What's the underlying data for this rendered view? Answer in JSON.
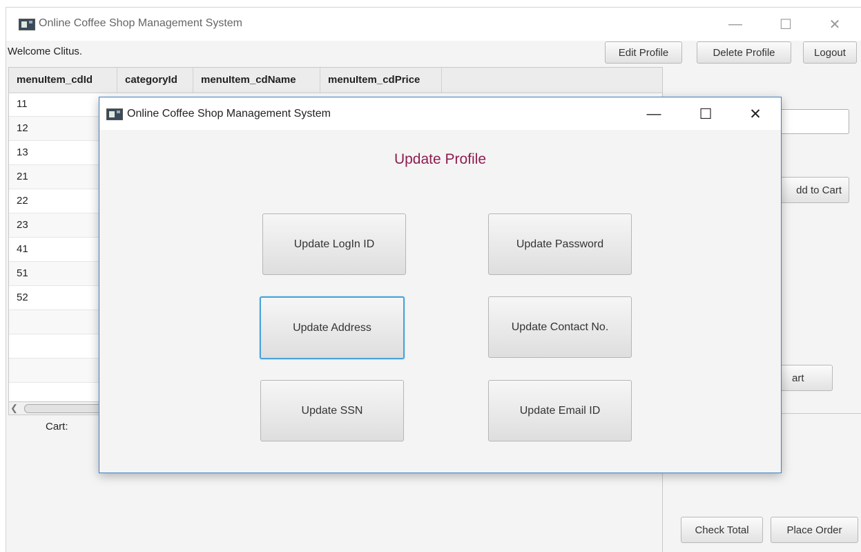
{
  "main_window": {
    "title": "Online Coffee Shop Management System",
    "controls": {
      "minimize": "—",
      "maximize": "☐",
      "close": "✕"
    },
    "welcome": "Welcome Clitus.",
    "toolbar": {
      "edit_profile": "Edit Profile",
      "delete_profile": "Delete Profile",
      "logout": "Logout"
    }
  },
  "table": {
    "columns": [
      "menuItem_cdId",
      "categoryId",
      "menuItem_cdName",
      "menuItem_cdPrice"
    ],
    "rows": [
      "11",
      "12",
      "13",
      "21",
      "22",
      "23",
      "41",
      "51",
      "52",
      "",
      "",
      ""
    ]
  },
  "cart": {
    "label": "Cart:"
  },
  "right_panel": {
    "add_to_cart_partial": "dd to Cart",
    "cart_partial": "art",
    "check_total": "Check Total",
    "place_order": "Place Order"
  },
  "dialog": {
    "title": "Online Coffee Shop Management System",
    "controls": {
      "minimize": "—",
      "maximize": "☐",
      "close": "✕"
    },
    "heading": "Update Profile",
    "buttons": {
      "update_login_id": "Update LogIn ID",
      "update_password": "Update Password",
      "update_address": "Update Address",
      "update_contact": "Update Contact No.",
      "update_ssn": "Update SSN",
      "update_email": "Update Email ID"
    },
    "focused_button": "Update Address"
  },
  "colors": {
    "dialog_border": "#3b7fc4",
    "heading": "#8e1d4f",
    "focus_ring": "#49a3d9"
  }
}
